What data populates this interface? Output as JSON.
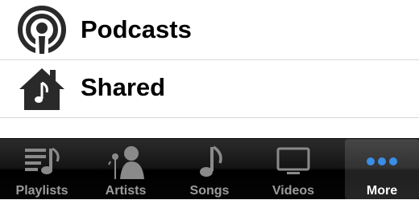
{
  "list": {
    "items": [
      {
        "label": "Podcasts",
        "icon": "podcast-icon"
      },
      {
        "label": "Shared",
        "icon": "shared-home-icon"
      }
    ]
  },
  "tabbar": {
    "tabs": [
      {
        "label": "Playlists",
        "icon": "playlists-icon",
        "selected": false
      },
      {
        "label": "Artists",
        "icon": "artists-icon",
        "selected": false
      },
      {
        "label": "Songs",
        "icon": "songs-icon",
        "selected": false
      },
      {
        "label": "Videos",
        "icon": "videos-icon",
        "selected": false
      },
      {
        "label": "More",
        "icon": "more-icon",
        "selected": true
      }
    ]
  },
  "colors": {
    "tab_inactive": "#9b9b9b",
    "tab_active": "#ffffff",
    "more_dots": "#3a8ee6",
    "separator": "#d9d9d9"
  }
}
